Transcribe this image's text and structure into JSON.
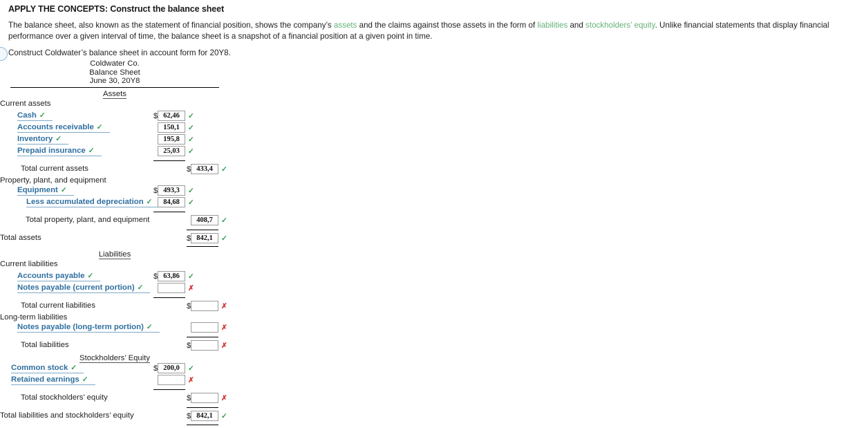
{
  "intro": {
    "title": "APPLY THE CONCEPTS: Construct the balance sheet",
    "para_1": "The balance sheet, also known as the statement of financial position, shows the company’s ",
    "term_assets": "assets",
    "para_2": " and the claims against those assets in the form of ",
    "term_liabilities": "liabilities",
    "para_3": " and ",
    "term_equity": "stockholders’ equity",
    "para_4": ". Unlike financial statements that display financial performance over a given interval of time, the balance sheet is a snapshot of a financial position at a given point in time.",
    "instruction": "Construct Coldwater’s balance sheet in account form for 20Y8."
  },
  "sheet": {
    "company": "Coldwater Co.",
    "statement": "Balance Sheet",
    "date": "June 30, 20Y8",
    "assets_heading": "Assets",
    "liabilities_heading": "Liabilities",
    "equity_heading": "Stockholders’ Equity",
    "groups": {
      "current_assets": "Current assets",
      "ppe": "Property, plant, and equipment",
      "current_liabilities": "Current liabilities",
      "long_term_liabilities": "Long-term liabilities"
    },
    "rows": {
      "cash": {
        "label": "Cash",
        "value": "62,46",
        "dollar": "$",
        "mark": "✓",
        "status": "ok"
      },
      "accounts_receivable": {
        "label": "Accounts receivable",
        "value": "150,1",
        "mark": "✓",
        "status": "ok"
      },
      "inventory": {
        "label": "Inventory",
        "value": "195,8",
        "mark": "✓",
        "status": "ok"
      },
      "prepaid_insurance": {
        "label": "Prepaid insurance",
        "value": "25,03",
        "mark": "✓",
        "status": "ok"
      },
      "total_current_assets": {
        "label": "Total current assets",
        "value": "433,4",
        "dollar": "$",
        "mark": "✓",
        "status": "ok"
      },
      "equipment": {
        "label": "Equipment",
        "value": "493,3",
        "dollar": "$",
        "mark": "✓",
        "status": "ok"
      },
      "less_accum_depreciation": {
        "label": "Less accumulated depreciation",
        "value": "84,68",
        "mark": "✓",
        "status": "ok"
      },
      "total_ppe": {
        "label": "Total property, plant, and equipment",
        "value": "408,7",
        "mark": "✓",
        "status": "ok"
      },
      "total_assets": {
        "label": "Total assets",
        "value": "842,1",
        "dollar": "$",
        "mark": "✓",
        "status": "ok"
      },
      "accounts_payable": {
        "label": "Accounts payable",
        "value": "63,86",
        "dollar": "$",
        "mark": "✓",
        "status": "ok"
      },
      "notes_payable_current": {
        "label": "Notes payable (current portion)",
        "value": "",
        "mark": "✗",
        "status": "bad"
      },
      "total_current_liabilities": {
        "label": "Total current liabilities",
        "value": "",
        "dollar": "$",
        "mark": "✗",
        "status": "bad"
      },
      "notes_payable_long_term": {
        "label": "Notes payable (long-term portion)",
        "value": "",
        "mark": "✗",
        "status": "bad"
      },
      "total_liabilities": {
        "label": "Total liabilities",
        "value": "",
        "dollar": "$",
        "mark": "✗",
        "status": "bad"
      },
      "common_stock": {
        "label": "Common stock",
        "value": "200,0",
        "dollar": "$",
        "mark": "✓",
        "status": "ok"
      },
      "retained_earnings": {
        "label": "Retained earnings",
        "value": "",
        "mark": "✗",
        "status": "bad"
      },
      "total_equity": {
        "label": "Total stockholders’ equity",
        "value": "",
        "dollar": "$",
        "mark": "✗",
        "status": "bad"
      },
      "total_liab_equity": {
        "label": "Total liabilities and stockholders’ equity",
        "value": "842,1",
        "dollar": "$",
        "mark": "✓",
        "status": "ok"
      }
    },
    "select_ok_mark": "✓"
  },
  "colors": {
    "term_green": "#66b278",
    "account_blue": "#2f6f9f",
    "check_green": "#2f9e4f",
    "cross_red": "#d0322f"
  }
}
